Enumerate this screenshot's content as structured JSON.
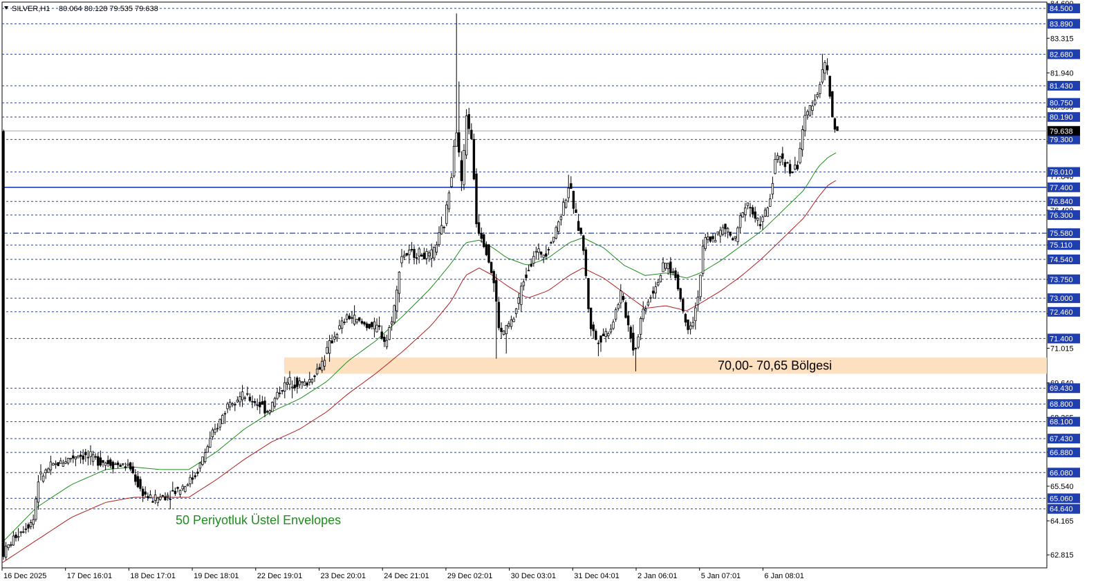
{
  "header": {
    "symbol": "SILVER,H1",
    "ohlc": "80.064 80.128 79.535 79.638"
  },
  "colors": {
    "candle": "#000000",
    "level_line": "#1f3fb0",
    "key_line": "#1f3fb0",
    "ema_upper": "#1e8c1e",
    "ema_lower": "#b01e1e",
    "zone_fill": "#fde0c0",
    "current_price_bg": "#000000",
    "level_label_bg": "#1f3fb0"
  },
  "chart_data": {
    "type": "candlestick",
    "title": "SILVER,H1",
    "ylim": [
      62.3,
      84.75
    ],
    "y_tick_labels": [
      "84.690",
      "83.315",
      "81.940",
      "80.590",
      "79.215",
      "77.840",
      "76.490",
      "75.115",
      "73.740",
      "72.390",
      "71.015",
      "69.640",
      "68.265",
      "66.890",
      "65.540",
      "64.165",
      "62.815"
    ],
    "x_tick_labels": [
      "16 Dec 2025",
      "17 Dec 16:01",
      "18 Dec 17:01",
      "19 Dec 18:01",
      "22 Dec 19:01",
      "23 Dec 20:01",
      "24 Dec 21:01",
      "29 Dec 02:01",
      "30 Dec 03:01",
      "31 Dec 04:01",
      "2 Jan 06:01",
      "5 Jan 07:01",
      "6 Jan 08:01"
    ],
    "levels": [
      "84.500",
      "83.890",
      "82.680",
      "81.430",
      "80.750",
      "80.190",
      "79.300",
      "78.010",
      "76.840",
      "76.300",
      "75.110",
      "74.540",
      "73.750",
      "73.000",
      "72.460",
      "71.400",
      "69.430",
      "68.800",
      "68.100",
      "67.430",
      "66.880",
      "66.080",
      "65.060",
      "64.640"
    ],
    "key_level": "77.400",
    "dashdot_level": "75.580",
    "current_price": "79.638",
    "zone": {
      "low": 70.0,
      "high": 70.65,
      "label": "70,00- 70,65 Bölgesi"
    },
    "indicator_label": "50 Periyotluk Üstel Envelopes",
    "price_path": [
      [
        0,
        62.8
      ],
      [
        20,
        63.6
      ],
      [
        45,
        64.2
      ],
      [
        52,
        65.8
      ],
      [
        70,
        66.3
      ],
      [
        110,
        66.8
      ],
      [
        150,
        66.5
      ],
      [
        185,
        66.3
      ],
      [
        200,
        65.4
      ],
      [
        215,
        65.0
      ],
      [
        240,
        65.2
      ],
      [
        265,
        65.6
      ],
      [
        280,
        66.0
      ],
      [
        300,
        67.3
      ],
      [
        318,
        68.3
      ],
      [
        330,
        69.0
      ],
      [
        350,
        69.1
      ],
      [
        372,
        68.8
      ],
      [
        385,
        68.5
      ],
      [
        400,
        69.3
      ],
      [
        415,
        69.7
      ],
      [
        440,
        69.6
      ],
      [
        460,
        70.3
      ],
      [
        478,
        71.4
      ],
      [
        500,
        72.3
      ],
      [
        520,
        72.0
      ],
      [
        545,
        71.8
      ],
      [
        555,
        71.2
      ],
      [
        570,
        73.0
      ],
      [
        576,
        74.7
      ],
      [
        600,
        74.8
      ],
      [
        620,
        74.6
      ],
      [
        640,
        76.0
      ],
      [
        650,
        78.0
      ],
      [
        656,
        80.0
      ],
      [
        665,
        77.5
      ],
      [
        672,
        80.4
      ],
      [
        680,
        79.0
      ],
      [
        686,
        76.0
      ],
      [
        700,
        75.0
      ],
      [
        712,
        73.5
      ],
      [
        720,
        71.5
      ],
      [
        740,
        72.2
      ],
      [
        755,
        73.8
      ],
      [
        770,
        74.8
      ],
      [
        785,
        74.8
      ],
      [
        800,
        75.6
      ],
      [
        815,
        77.0
      ],
      [
        820,
        77.5
      ],
      [
        830,
        76.2
      ],
      [
        840,
        75.2
      ],
      [
        850,
        72.0
      ],
      [
        860,
        71.3
      ],
      [
        880,
        71.8
      ],
      [
        895,
        73.2
      ],
      [
        905,
        72.0
      ],
      [
        915,
        70.8
      ],
      [
        925,
        72.4
      ],
      [
        945,
        73.5
      ],
      [
        960,
        74.4
      ],
      [
        975,
        73.8
      ],
      [
        990,
        71.8
      ],
      [
        1000,
        72.2
      ],
      [
        1008,
        73.4
      ],
      [
        1015,
        75.3
      ],
      [
        1030,
        75.4
      ],
      [
        1045,
        75.8
      ],
      [
        1060,
        75.2
      ],
      [
        1070,
        76.5
      ],
      [
        1080,
        76.8
      ],
      [
        1090,
        76.0
      ],
      [
        1100,
        76.1
      ],
      [
        1110,
        76.8
      ],
      [
        1118,
        78.5
      ],
      [
        1130,
        78.6
      ],
      [
        1140,
        78.0
      ],
      [
        1150,
        78.2
      ],
      [
        1158,
        79.8
      ],
      [
        1170,
        80.7
      ],
      [
        1180,
        81.2
      ],
      [
        1190,
        82.4
      ],
      [
        1196,
        81.5
      ],
      [
        1200,
        80.2
      ],
      [
        1208,
        79.6
      ]
    ],
    "ema_upper_path": [
      [
        0,
        63.3
      ],
      [
        50,
        64.7
      ],
      [
        100,
        65.6
      ],
      [
        150,
        66.2
      ],
      [
        190,
        66.3
      ],
      [
        230,
        66.2
      ],
      [
        270,
        66.2
      ],
      [
        310,
        66.9
      ],
      [
        350,
        67.8
      ],
      [
        390,
        68.5
      ],
      [
        430,
        69.0
      ],
      [
        470,
        69.7
      ],
      [
        500,
        70.5
      ],
      [
        540,
        71.3
      ],
      [
        580,
        72.3
      ],
      [
        620,
        73.4
      ],
      [
        650,
        74.4
      ],
      [
        670,
        75.2
      ],
      [
        690,
        75.3
      ],
      [
        710,
        75.0
      ],
      [
        730,
        74.6
      ],
      [
        760,
        74.3
      ],
      [
        790,
        74.6
      ],
      [
        820,
        75.2
      ],
      [
        840,
        75.4
      ],
      [
        870,
        75.0
      ],
      [
        900,
        74.3
      ],
      [
        930,
        73.9
      ],
      [
        960,
        74.0
      ],
      [
        990,
        73.8
      ],
      [
        1010,
        74.0
      ],
      [
        1040,
        74.5
      ],
      [
        1070,
        75.1
      ],
      [
        1100,
        75.7
      ],
      [
        1130,
        76.5
      ],
      [
        1160,
        77.3
      ],
      [
        1180,
        78.2
      ],
      [
        1195,
        78.6
      ],
      [
        1208,
        78.8
      ]
    ],
    "ema_lower_path": [
      [
        0,
        62.5
      ],
      [
        50,
        63.4
      ],
      [
        100,
        64.3
      ],
      [
        150,
        64.9
      ],
      [
        190,
        65.1
      ],
      [
        230,
        65.1
      ],
      [
        270,
        65.1
      ],
      [
        310,
        65.8
      ],
      [
        350,
        66.6
      ],
      [
        390,
        67.3
      ],
      [
        430,
        67.8
      ],
      [
        470,
        68.5
      ],
      [
        500,
        69.2
      ],
      [
        540,
        70.0
      ],
      [
        580,
        70.9
      ],
      [
        620,
        71.9
      ],
      [
        650,
        72.9
      ],
      [
        670,
        73.9
      ],
      [
        690,
        74.2
      ],
      [
        710,
        73.9
      ],
      [
        730,
        73.5
      ],
      [
        760,
        73.0
      ],
      [
        790,
        73.3
      ],
      [
        820,
        73.9
      ],
      [
        840,
        74.2
      ],
      [
        870,
        73.8
      ],
      [
        900,
        73.2
      ],
      [
        930,
        72.6
      ],
      [
        960,
        72.7
      ],
      [
        990,
        72.5
      ],
      [
        1010,
        72.8
      ],
      [
        1040,
        73.3
      ],
      [
        1070,
        73.9
      ],
      [
        1100,
        74.6
      ],
      [
        1130,
        75.4
      ],
      [
        1160,
        76.2
      ],
      [
        1180,
        77.0
      ],
      [
        1195,
        77.5
      ],
      [
        1208,
        77.7
      ]
    ]
  }
}
